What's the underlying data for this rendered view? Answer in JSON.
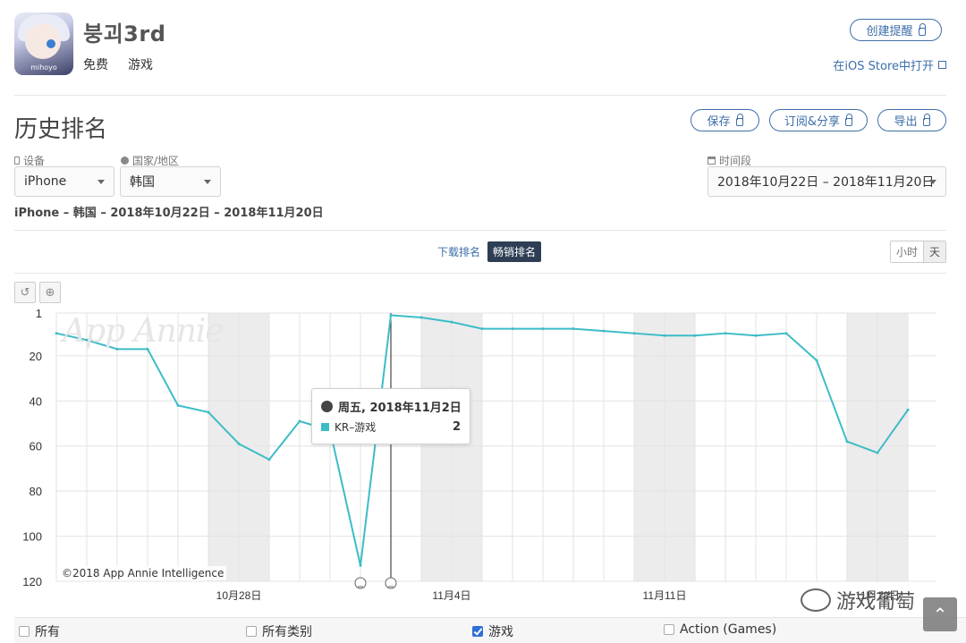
{
  "app": {
    "title": "붕괴3rd",
    "icon_brand": "mihoyo",
    "price": "免费",
    "category": "游戏",
    "create_alert_label": "创建提醒",
    "ios_store_label": "在iOS Store中打开"
  },
  "section": {
    "title": "历史排名",
    "save_label": "保存",
    "subscribe_label": "订阅&分享",
    "export_label": "导出"
  },
  "filters": {
    "device_label": "设备",
    "device_value": "iPhone",
    "country_label": "国家/地区",
    "country_value": "韩国",
    "period_label": "时间段",
    "period_value": "2018年10月22日 – 2018年11月20日",
    "summary": "iPhone – 韩国 – 2018年10月22日 – 2018年11月20日"
  },
  "rank_tabs": {
    "download": "下载排名",
    "grossing": "畅销排名",
    "active": "grossing"
  },
  "unit_tabs": {
    "hour": "小时",
    "day": "天",
    "active": "day"
  },
  "tooltip": {
    "date": "周五, 2018年11月2日",
    "series": "KR–游戏",
    "value": "2"
  },
  "watermark": "App Annie",
  "copyright": "©2018 App Annie Intelligence",
  "category_filters": [
    {
      "label": "所有",
      "checked": false
    },
    {
      "label": "所有类别",
      "checked": false
    },
    {
      "label": "游戏",
      "checked": true
    },
    {
      "label": "Action (Games)",
      "checked": false
    }
  ],
  "overlay_watermark": "游戏葡萄",
  "chart_data": {
    "type": "line",
    "y_reversed": true,
    "ylim": [
      1,
      120
    ],
    "y_ticks": [
      1,
      20,
      40,
      60,
      80,
      100,
      120
    ],
    "x_tick_labels": [
      {
        "day": 6,
        "label": "10月28日"
      },
      {
        "day": 13,
        "label": "11月4日"
      },
      {
        "day": 20,
        "label": "11月11日"
      },
      {
        "day": 27,
        "label": "11月18日"
      }
    ],
    "x": [
      "10/22",
      "10/23",
      "10/24",
      "10/25",
      "10/26",
      "10/27",
      "10/28",
      "10/29",
      "10/30",
      "10/31",
      "11/1",
      "11/2",
      "11/3",
      "11/4",
      "11/5",
      "11/6",
      "11/7",
      "11/8",
      "11/9",
      "11/10",
      "11/11",
      "11/12",
      "11/13",
      "11/14",
      "11/15",
      "11/16",
      "11/17",
      "11/18",
      "11/19"
    ],
    "series": [
      {
        "name": "KR–游戏",
        "color": "#3dbcc6",
        "values": [
          10,
          13,
          17,
          17,
          42,
          45,
          59,
          66,
          49,
          53,
          113,
          2,
          3,
          5,
          8,
          8,
          8,
          8,
          9,
          10,
          11,
          11,
          10,
          11,
          10,
          22,
          58,
          63,
          44
        ]
      }
    ],
    "weekend_shaded": true,
    "selected_index": 11,
    "grid": true
  }
}
